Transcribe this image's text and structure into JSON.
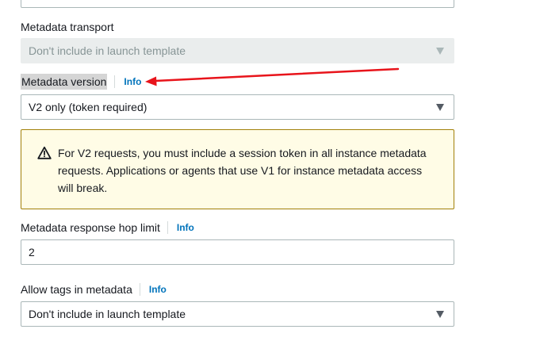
{
  "metadata_transport": {
    "label": "Metadata transport",
    "value": "Don't include in launch template",
    "disabled": true
  },
  "metadata_version": {
    "label": "Metadata version",
    "info": "Info",
    "value": "V2 only (token required)"
  },
  "warning": {
    "text": "For V2 requests, you must include a session token in all instance metadata requests. Applications or agents that use V1 for instance metadata access will break."
  },
  "hop_limit": {
    "label": "Metadata response hop limit",
    "info": "Info",
    "value": "2"
  },
  "tags_in_metadata": {
    "label": "Allow tags in metadata",
    "info": "Info",
    "value": "Don't include in launch template"
  },
  "colors": {
    "link": "#0073bb",
    "warning_border": "#a28009",
    "warning_bg": "#fffce6",
    "annotation_arrow": "#e8141b"
  },
  "icons": {
    "warning": "warning-triangle-icon",
    "caret": "caret-down-icon"
  }
}
